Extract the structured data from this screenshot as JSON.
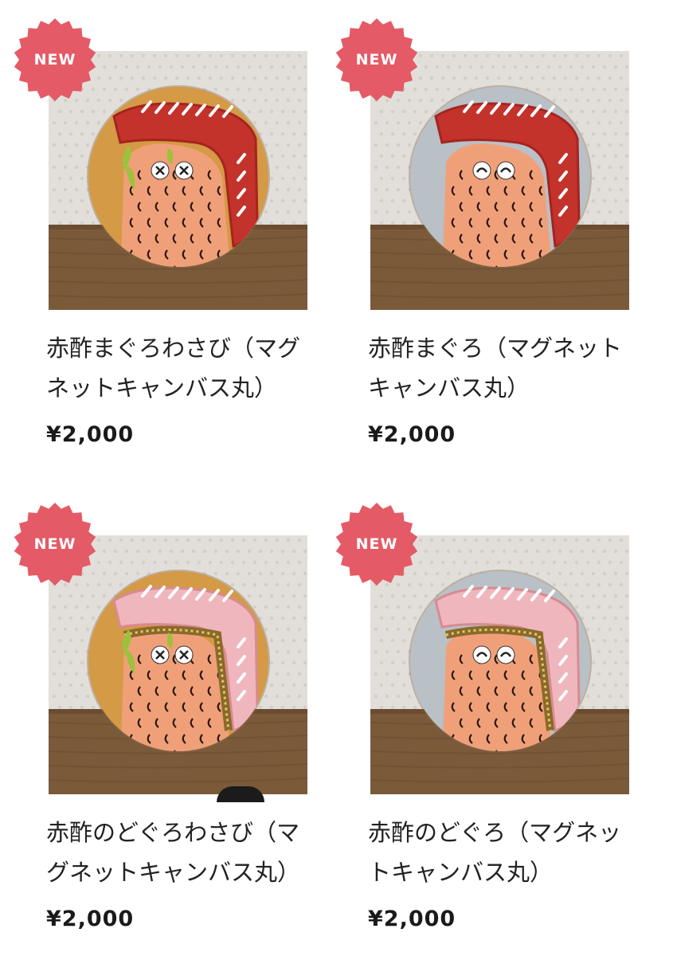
{
  "colors": {
    "badge": "#e45a66",
    "title": "#222222",
    "price": "#1a1a1a"
  },
  "products": [
    {
      "badge": "NEW",
      "title": "赤酢まぐろわさび（マグネットキャンバス丸）",
      "price": "¥2,000",
      "image": {
        "subject": "maguro-wasabi-character",
        "background": "gold",
        "topping": "tuna-red",
        "wasabi": true,
        "eyes": "x"
      }
    },
    {
      "badge": "NEW",
      "title": "赤酢まぐろ（マグネットキャンバス丸）",
      "price": "¥2,000",
      "image": {
        "subject": "maguro-character",
        "background": "silver",
        "topping": "tuna-red",
        "wasabi": false,
        "eyes": "smile"
      }
    },
    {
      "badge": "NEW",
      "title": "赤酢のどぐろわさび（マグネットキャンバス丸）",
      "price": "¥2,000",
      "image": {
        "subject": "nodoguro-wasabi-character",
        "background": "gold",
        "topping": "nodoguro-pink",
        "wasabi": true,
        "eyes": "x"
      }
    },
    {
      "badge": "NEW",
      "title": "赤酢のどぐろ（マグネットキャンバス丸）",
      "price": "¥2,000",
      "image": {
        "subject": "nodoguro-character",
        "background": "silver",
        "topping": "nodoguro-pink",
        "wasabi": false,
        "eyes": "smile"
      }
    }
  ]
}
